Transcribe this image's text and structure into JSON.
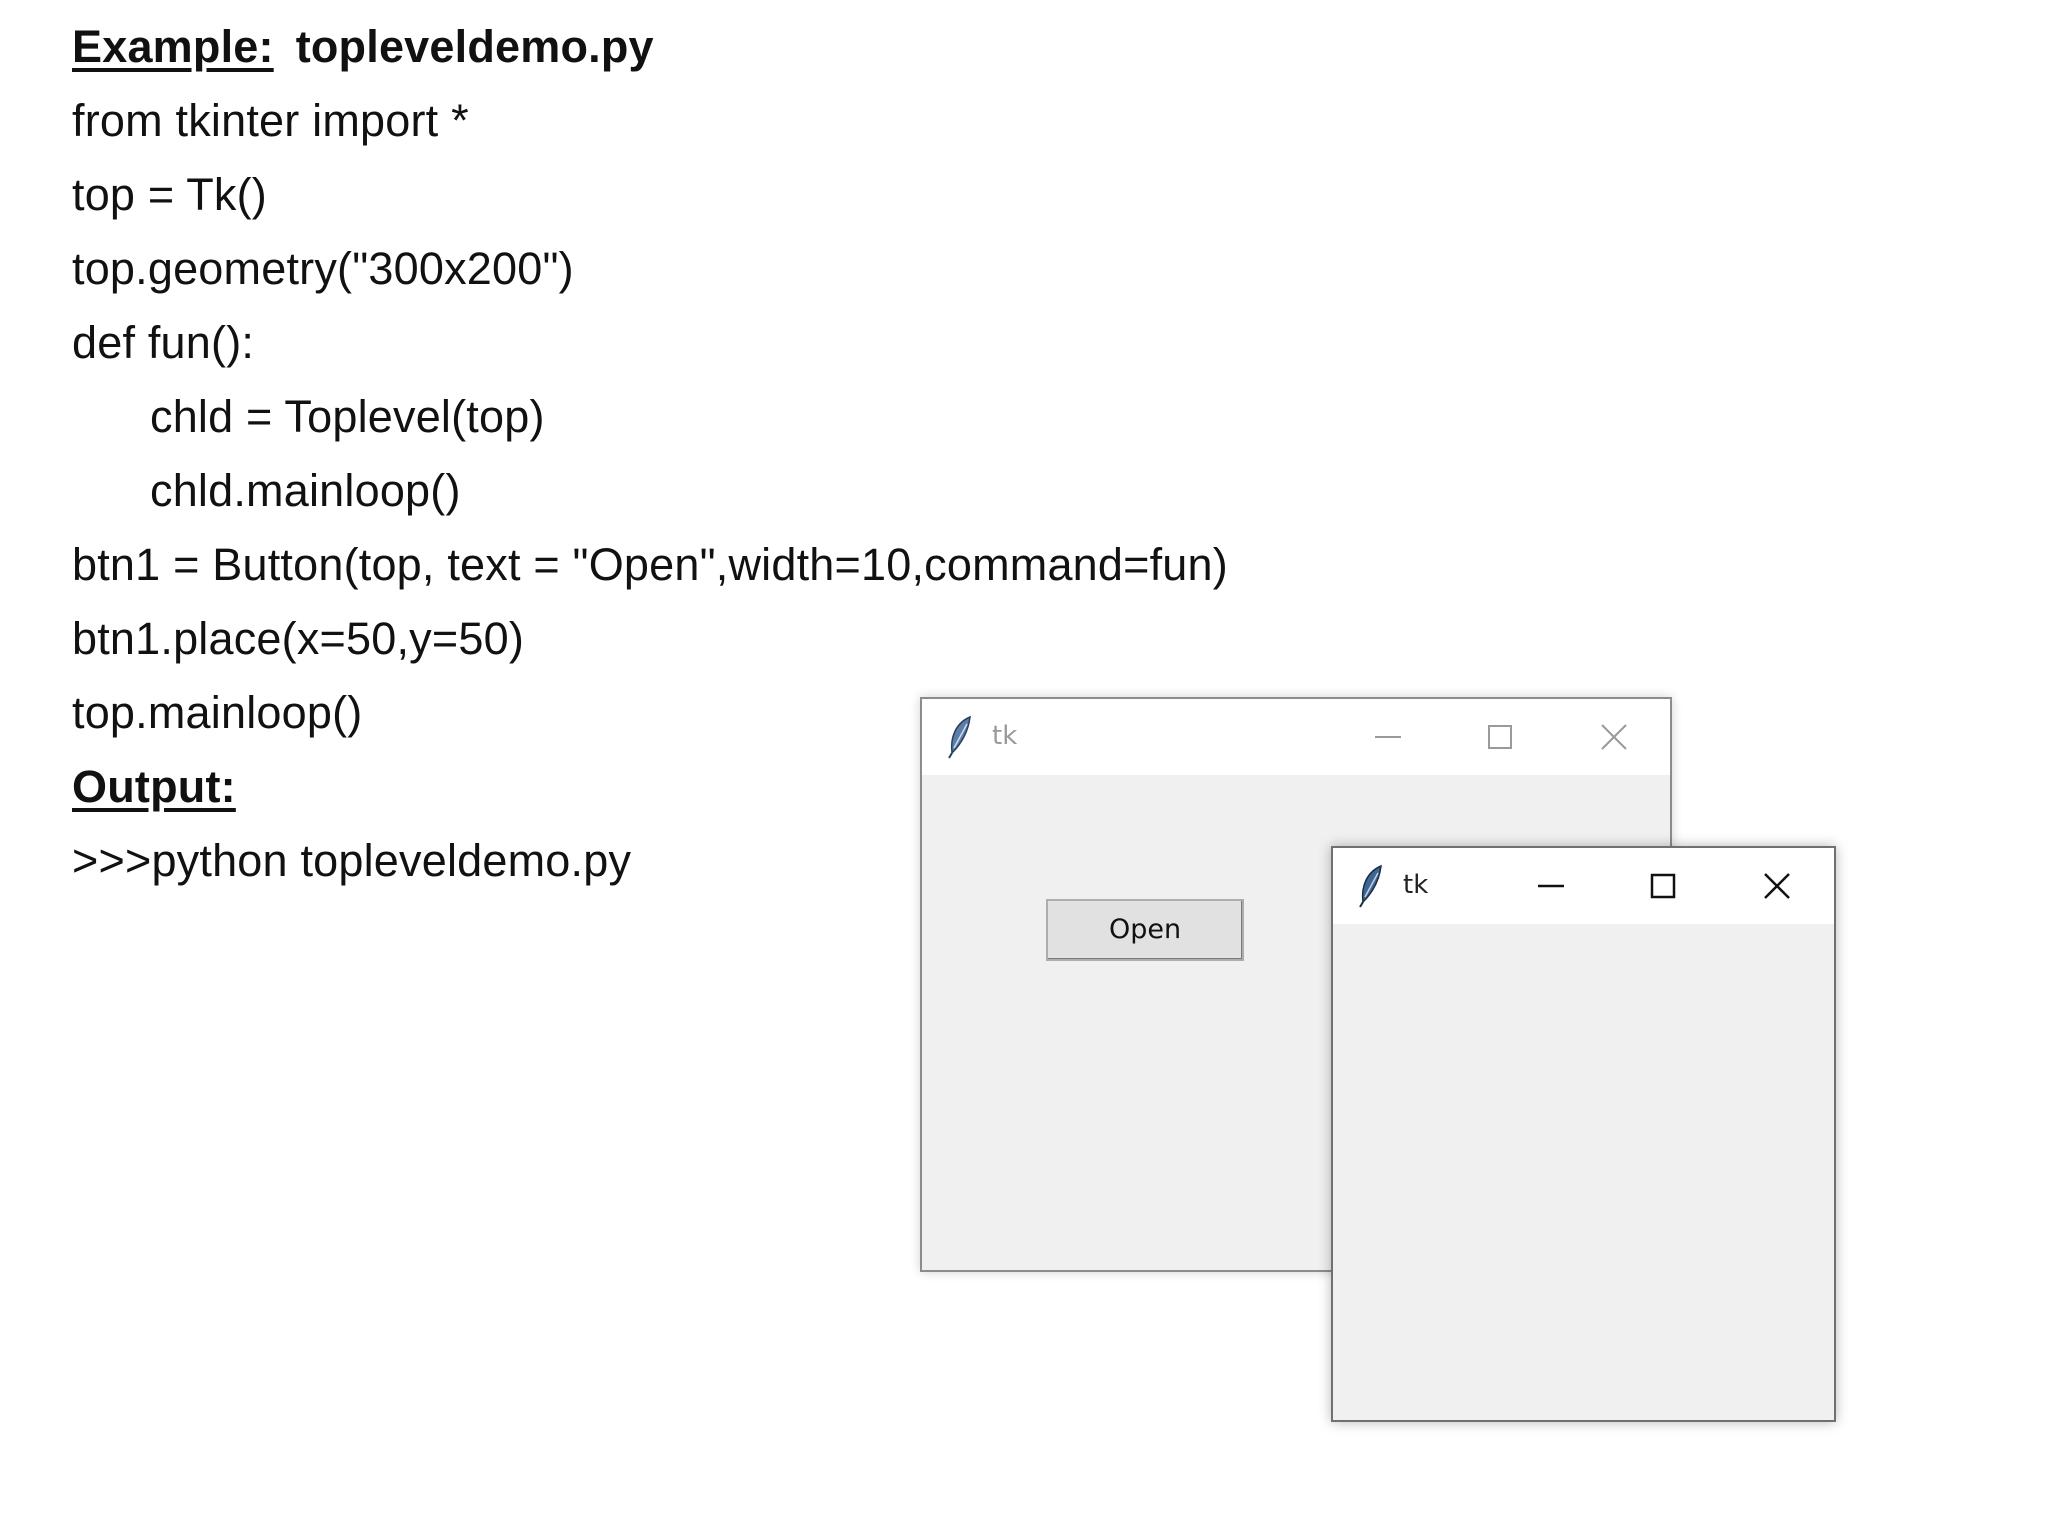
{
  "document": {
    "example_label": "Example:",
    "example_file": "topleveldemo.py",
    "code_lines": [
      "from tkinter import *",
      "top = Tk()",
      "top.geometry(\"300x200\")",
      "def fun():",
      "chld = Toplevel(top)",
      "chld.mainloop()",
      "btn1 = Button(top, text = \"Open\",width=10,command=fun)",
      "btn1.place(x=50,y=50)",
      "top.mainloop()"
    ],
    "output_label": "Output:",
    "command_line": ">>>python topleveldemo.py"
  },
  "main_window": {
    "title": "tk",
    "state": "inactive",
    "button_label": "Open"
  },
  "child_window": {
    "title": "tk",
    "state": "active"
  },
  "icons": {
    "app": "feather-icon",
    "minimize": "minimize-icon",
    "maximize": "maximize-icon",
    "close": "close-icon"
  },
  "colors": {
    "window_background": "#f0f0f0",
    "titlebar": "#ffffff",
    "inactive_title": "#9a9a9a",
    "active_title": "#222222"
  }
}
